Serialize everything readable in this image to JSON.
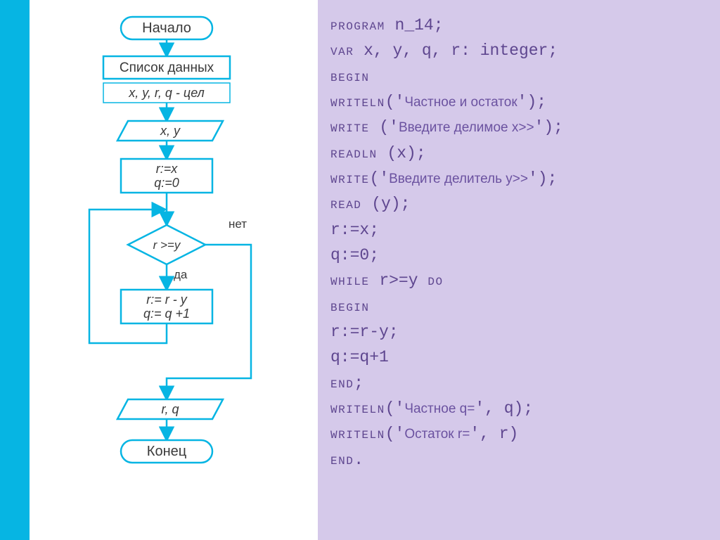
{
  "flowchart": {
    "start": "Начало",
    "data_header": "Список данных",
    "data_vars": "x, y, r, q - цел",
    "input": "x, y",
    "init1": "r:=x",
    "init2": "q:=0",
    "cond": "r >=y",
    "yes": "да",
    "no": "нет",
    "body1": "r:= r - y",
    "body2": "q:= q +1",
    "output": "r, q",
    "end": "Конец"
  },
  "code": {
    "l1a": "program",
    "l1b": " n_14;",
    "l2a": "  var",
    "l2b": " x, y, q, r: integer;",
    "l3": "begin",
    "l4a": "  writeln",
    "l4b": "('",
    "l4c": "Частное и остаток",
    "l4d": "');",
    "l5a": "  write",
    "l5b": "  ('",
    "l5c": "Введите делимое x>>",
    "l5d": "');",
    "l6a": "  readln",
    "l6b": " (x);",
    "l7a": "  write",
    "l7b": "('",
    "l7c": "Введите делитель y>>",
    "l7d": "');",
    "l8a": "  read",
    "l8b": " (y);",
    "l9": "  r:=x;",
    "l10": "  q:=0;",
    "l11a": "  while",
    "l11b": " r>=y ",
    "l11c": "do",
    "l12": "  begin",
    "l13": "   r:=r-y;",
    "l14": "   q:=q+1",
    "l15": "  end;",
    "l16a": "  writeln",
    "l16b": "('",
    "l16c": "Частное q=",
    "l16d": "', q);",
    "l17a": "  writeln",
    "l17b": "('",
    "l17c": "Остаток r=",
    "l17d": "', r)",
    "l18": "end."
  }
}
